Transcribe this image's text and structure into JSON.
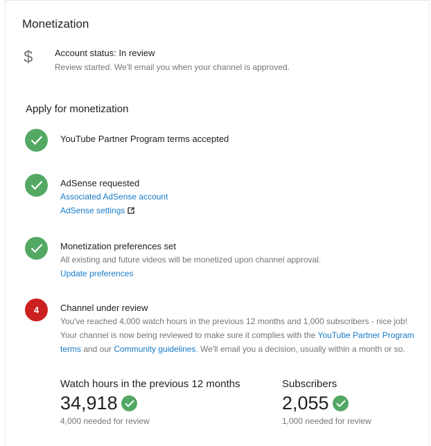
{
  "page": {
    "title": "Monetization"
  },
  "account_status": {
    "icon": "dollar-icon",
    "title": "Account status: In review",
    "description": "Review started. We'll email you when your channel is approved."
  },
  "apply": {
    "title": "Apply for monetization",
    "steps": [
      {
        "title": "YouTube Partner Program terms accepted",
        "status": "complete"
      },
      {
        "title": "AdSense requested",
        "status": "complete",
        "links": [
          "Associated AdSense account",
          "AdSense settings"
        ]
      },
      {
        "title": "Monetization preferences set",
        "status": "complete",
        "description": "All existing and future videos will be monetized upon channel approval.",
        "links": [
          "Update preferences"
        ]
      },
      {
        "title": "Channel under review",
        "status": "in_progress",
        "number": "4",
        "desc_part1": "You've reached 4,000 watch hours in the previous 12 months and 1,000 subscribers - nice job! Your channel is now being reviewed to make sure it complies with the ",
        "link1": "YouTube Partner Program terms",
        "desc_part2": " and our ",
        "link2": "Community guidelines",
        "desc_part3": ". We'll email you a decision, usually within a month or so."
      }
    ]
  },
  "stats": {
    "watch_hours": {
      "label": "Watch hours in the previous 12 months",
      "value": "34,918",
      "note": "4,000 needed for review"
    },
    "subscribers": {
      "label": "Subscribers",
      "value": "2,055",
      "note": "1,000 needed for review"
    }
  },
  "colors": {
    "accent_green": "#53a964",
    "alert_red": "#cc1f1f",
    "link_blue": "#167ac6"
  }
}
